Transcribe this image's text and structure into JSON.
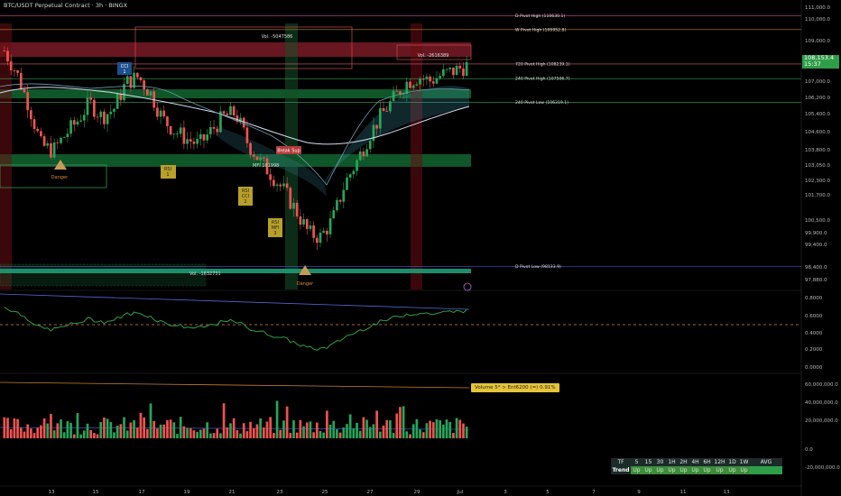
{
  "header": {
    "title": "BTC/USDT Perpetual Contract · 3h · BINGX"
  },
  "last_price": {
    "value": "108,153.4",
    "countdown": "15:37"
  },
  "levels": [
    {
      "label": "D Pivot High (110630.1)",
      "price": 110630.1,
      "color": "#d24a8d"
    },
    {
      "label": "W Pivot High (109952.8)",
      "price": 109952.8,
      "color": "#c97f2a"
    },
    {
      "label": "720 Pivot High (108239.1)",
      "price": 108239.1,
      "color": "#e05a7a"
    },
    {
      "label": "240 Pivot High (107506.7)",
      "price": 107506.7,
      "color": "#3aa55a"
    },
    {
      "label": "240 Pivot Low (106319.1)",
      "price": 106319.1,
      "color": "#3aa55a"
    },
    {
      "label": "D Pivot Low (98133.9)",
      "price": 98133.9,
      "color": "#4455cc"
    }
  ],
  "vol_labels": [
    "Vol. -5047586",
    "Vol. -2616389",
    "Vol. -1632731"
  ],
  "signals": {
    "cci": [
      "CCI",
      "1"
    ],
    "rsi1": [
      "RSI",
      "1"
    ],
    "rsi_cci2": [
      "RSI",
      "CCI",
      "2"
    ],
    "rsi_mfi3": [
      "RSI",
      "MFI",
      "3"
    ],
    "break_sup": "Break Sup",
    "danger": "Danger",
    "mfi_label": "MFI 101998"
  },
  "volume_label": "Volume 5* > Ent6200 (=) 0.91%",
  "x_ticks": [
    "13",
    "15",
    "17",
    "19",
    "21",
    "23",
    "25",
    "27",
    "29",
    "Jul",
    "3",
    "5",
    "7",
    "9",
    "11",
    "13"
  ],
  "price_axis": [
    "111,000.0",
    "110,000.0",
    "109,000.0",
    "107,000.0",
    "106,200.0",
    "105,400.0",
    "104,600.0",
    "103,800.0",
    "103,050.0",
    "102,300.0",
    "101,700.0",
    "100,500.0",
    "99,900.0",
    "99,400.0",
    "98,400.0",
    "97,880.0"
  ],
  "osc_axis": [
    "0.8000",
    "0.6000",
    "0.4000",
    "0.2000",
    "0.0000"
  ],
  "vol_axis": [
    "60,000,000.0",
    "40,000,000.0",
    "20,000,000.0",
    "0.0",
    "-20,000,000.0"
  ],
  "trend_table": {
    "headers": [
      "TF",
      "5",
      "15",
      "30",
      "1H",
      "2H",
      "4H",
      "6H",
      "12H",
      "1D",
      "1W",
      "AVG"
    ],
    "row_label": "Trend",
    "values": [
      "Up",
      "Up",
      "Up",
      "Up",
      "Up",
      "Up",
      "Up",
      "Up",
      "Up",
      "Up",
      ""
    ]
  },
  "colors": {
    "up": "#26a65b",
    "down": "#ef5350",
    "background": "#000000",
    "ema": "#a9b4d9"
  },
  "chart_data": {
    "type": "candlestick",
    "title": "BTC/USDT Perpetual Contract · 3h · BINGX",
    "x_range": [
      "Jun 12",
      "Jul 14"
    ],
    "y_range": [
      97700,
      111200
    ],
    "close_path": [
      108900,
      107800,
      106200,
      104200,
      103900,
      104700,
      105400,
      106300,
      105600,
      106000,
      107300,
      107600,
      106800,
      105500,
      104900,
      104500,
      104200,
      104900,
      105600,
      105800,
      104300,
      103400,
      102700,
      101900,
      100900,
      99800,
      99600,
      100500,
      102300,
      103400,
      104700,
      105700,
      106500,
      107300,
      107600,
      107400,
      107700,
      107900,
      108153.4
    ]
  }
}
